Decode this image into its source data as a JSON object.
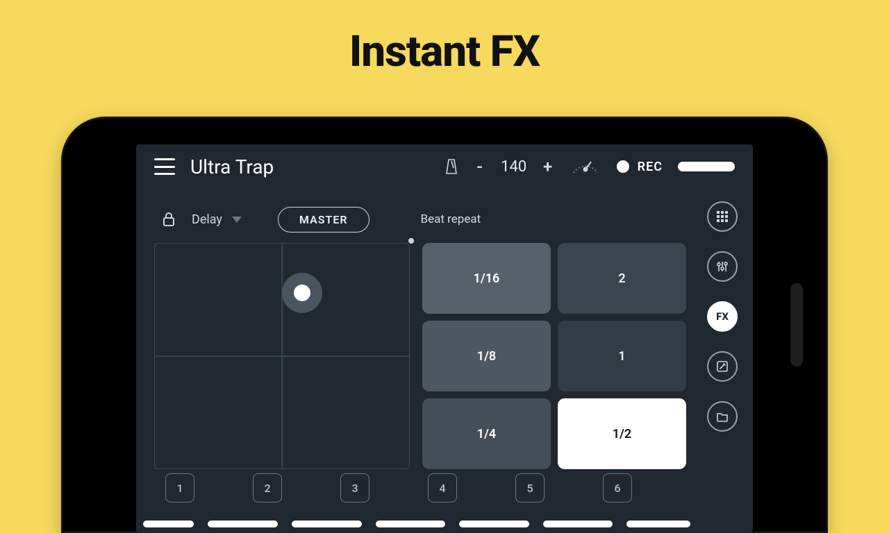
{
  "hero": {
    "title": "Instant FX"
  },
  "topbar": {
    "project_title": "Ultra Trap",
    "tempo_value": "140",
    "tempo_minus": "-",
    "tempo_plus": "+",
    "rec_label": "REC"
  },
  "fx": {
    "effect_name": "Delay",
    "master_label": "MASTER",
    "beat_repeat_label": "Beat repeat"
  },
  "beat_repeat": {
    "cells": [
      "1/16",
      "2",
      "1/8",
      "1",
      "1/4",
      "1/2"
    ],
    "active_index": 5
  },
  "rightnav": {
    "fx_label": "FX"
  },
  "channels": {
    "labels": [
      "1",
      "2",
      "3",
      "4",
      "5",
      "6"
    ]
  }
}
